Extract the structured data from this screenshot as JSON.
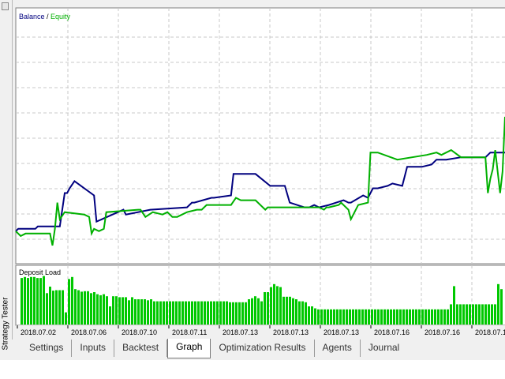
{
  "window": {
    "side_title": "Strategy Tester"
  },
  "tabs": [
    {
      "label": "Settings",
      "active": false
    },
    {
      "label": "Inputs",
      "active": false
    },
    {
      "label": "Backtest",
      "active": false
    },
    {
      "label": "Graph",
      "active": true
    },
    {
      "label": "Optimization Results",
      "active": false
    },
    {
      "label": "Agents",
      "active": false
    },
    {
      "label": "Journal",
      "active": false
    }
  ],
  "colors": {
    "balance": "#00007f",
    "equity": "#00b000",
    "deposit_load": "#00c800",
    "grid": "#c8c8c8",
    "background": "#ffffff"
  },
  "chart_data": [
    {
      "type": "line",
      "legend": {
        "balance_label": "Balance",
        "separator": " / ",
        "equity_label": "Equity",
        "placement": "top-left"
      },
      "grid": true,
      "x_tick_labels": [
        "2018.07.02",
        "2018.07.06",
        "2018.07.10",
        "2018.07.11",
        "2018.07.13",
        "2018.07.13",
        "2018.07.13",
        "2018.07.16",
        "2018.07.16",
        "2018.07.1"
      ],
      "x_range": [
        0,
        100
      ],
      "y_range": [
        0,
        100
      ],
      "series": [
        {
          "name": "Balance",
          "x": [
            0,
            0.5,
            4,
            4.5,
            9,
            10,
            10.5,
            11,
            12,
            16,
            16.5,
            22,
            22.5,
            27.5,
            35,
            35.5,
            36,
            36.5,
            40,
            40.5,
            44,
            44.5,
            49,
            52,
            55,
            56,
            59,
            60,
            61,
            62,
            64,
            67,
            68,
            68.5,
            71,
            72,
            73,
            74,
            76,
            77,
            79,
            80,
            83,
            85,
            86,
            88,
            91,
            96,
            97,
            100
          ],
          "y": [
            9,
            10,
            10,
            11,
            11,
            25,
            25,
            27,
            30,
            24,
            13,
            18,
            16,
            18,
            19,
            20,
            21,
            21,
            23,
            23,
            24,
            33,
            33,
            28,
            28,
            21,
            19,
            19,
            20,
            19,
            20,
            22,
            21,
            21,
            24,
            23,
            27,
            27,
            28,
            29,
            28,
            36,
            36,
            37,
            39,
            39,
            40,
            40,
            42,
            42
          ]
        },
        {
          "name": "Equity",
          "x": [
            0,
            1,
            2,
            7,
            7.5,
            8,
            8.5,
            9,
            10,
            14,
            15,
            15.5,
            16,
            17,
            18,
            18.5,
            25,
            25.5,
            26.5,
            28,
            30,
            31,
            32,
            33,
            35,
            37,
            38,
            39,
            44,
            45,
            46,
            49,
            51,
            51.5,
            53,
            62,
            63,
            63.5,
            64,
            66,
            66.5,
            68,
            68.5,
            70,
            72,
            72.5,
            74,
            78,
            84,
            86,
            87,
            89,
            91,
            96,
            96.5,
            97,
            97.5,
            98,
            99,
            99.5,
            100
          ],
          "y": [
            9,
            7,
            8,
            8,
            3,
            10,
            21,
            14,
            17,
            16,
            15,
            8,
            10,
            9,
            10,
            17,
            18,
            18,
            15,
            17,
            16,
            17,
            15,
            15,
            17,
            18,
            18,
            20,
            20,
            23,
            22,
            22,
            18,
            19,
            19,
            19,
            18,
            19,
            19,
            20,
            21,
            18,
            14,
            20,
            21,
            42,
            42,
            39,
            41,
            42,
            41,
            43,
            40,
            40,
            25,
            31,
            35,
            43,
            25,
            34,
            57
          ]
        }
      ]
    },
    {
      "type": "bar",
      "title": "Deposit Load",
      "y_range": [
        0,
        100
      ],
      "values": [
        92,
        94,
        92,
        94,
        94,
        92,
        92,
        96,
        62,
        75,
        67,
        68,
        68,
        68,
        24,
        90,
        94,
        70,
        68,
        65,
        66,
        66,
        62,
        64,
        60,
        58,
        60,
        56,
        36,
        56,
        56,
        54,
        54,
        54,
        48,
        54,
        50,
        50,
        50,
        50,
        48,
        50,
        46,
        46,
        46,
        46,
        46,
        46,
        46,
        46,
        46,
        46,
        46,
        46,
        46,
        46,
        46,
        46,
        46,
        46,
        46,
        46,
        46,
        46,
        46,
        46,
        44,
        44,
        44,
        44,
        44,
        44,
        50,
        52,
        56,
        52,
        46,
        64,
        64,
        74,
        80,
        76,
        74,
        55,
        55,
        55,
        52,
        50,
        46,
        46,
        44,
        36,
        36,
        32,
        30,
        30,
        30,
        30,
        30,
        30,
        30,
        30,
        30,
        30,
        30,
        30,
        30,
        30,
        30,
        30,
        30,
        30,
        30,
        30,
        30,
        30,
        30,
        30,
        30,
        30,
        30,
        30,
        30,
        30,
        30,
        30,
        30,
        30,
        30,
        30,
        30,
        30,
        30,
        30,
        30,
        30,
        40,
        76,
        40,
        40,
        40,
        40,
        40,
        40,
        40,
        40,
        40,
        40,
        40,
        40,
        40,
        80,
        70,
        50,
        46,
        46
      ]
    }
  ]
}
